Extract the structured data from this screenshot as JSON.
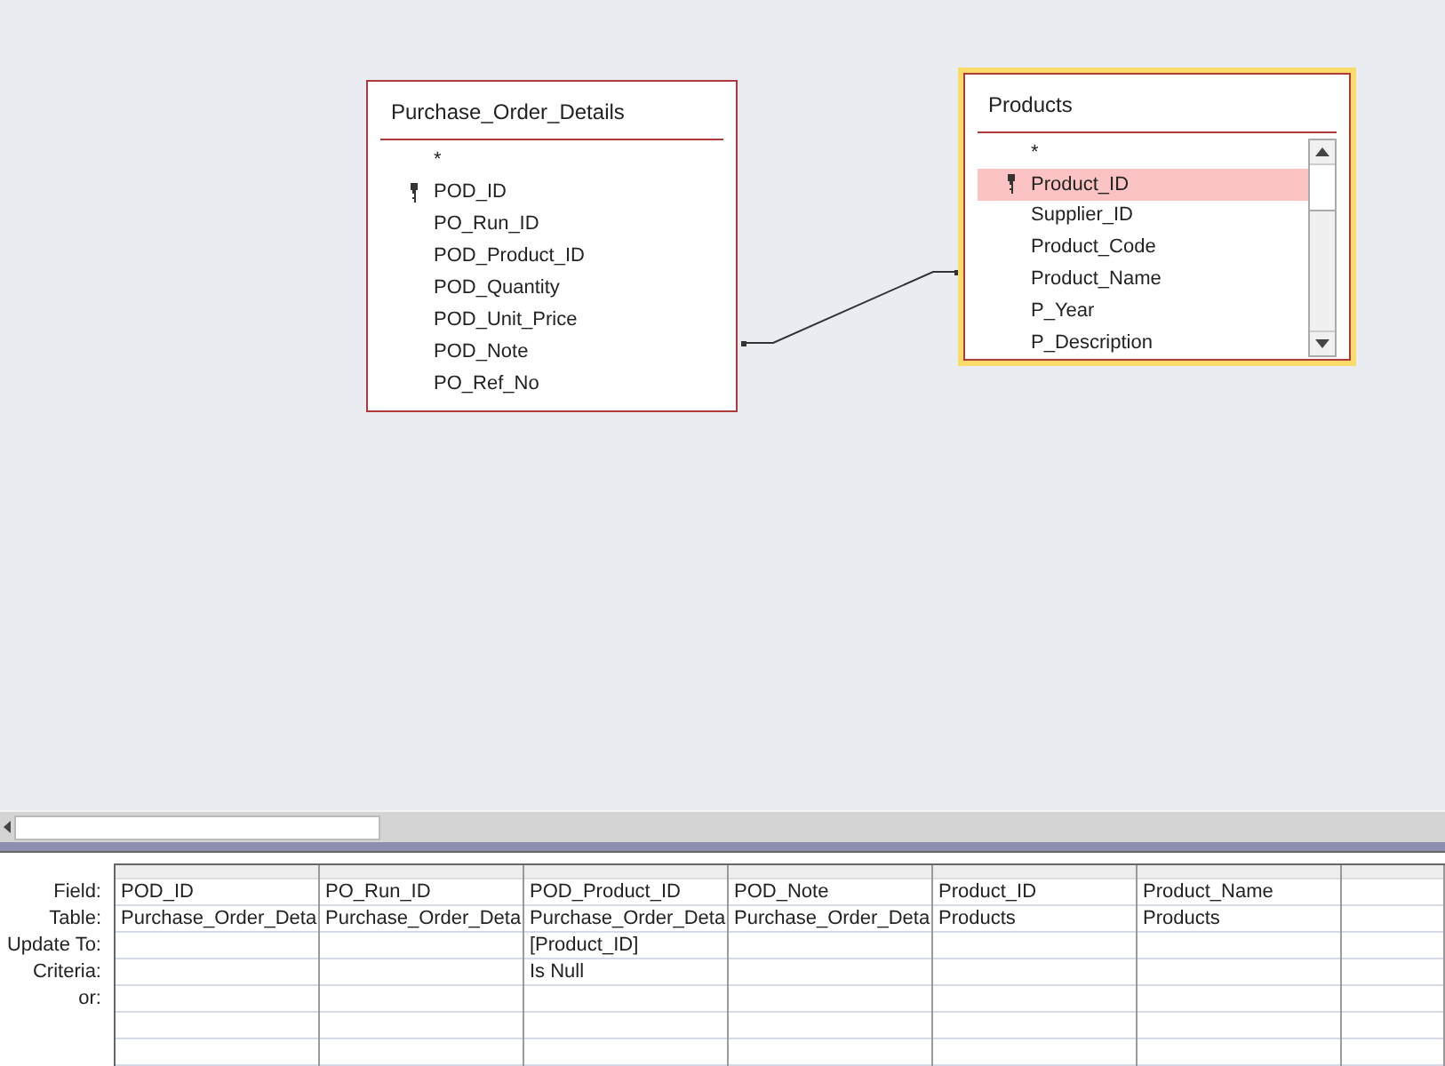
{
  "tables": [
    {
      "title": "Purchase_Order_Details",
      "active": false,
      "scrollable": false,
      "fields": [
        {
          "name": "*",
          "key": false,
          "selected": false
        },
        {
          "name": "POD_ID",
          "key": true,
          "selected": false
        },
        {
          "name": "PO_Run_ID",
          "key": false,
          "selected": false
        },
        {
          "name": "POD_Product_ID",
          "key": false,
          "selected": false
        },
        {
          "name": "POD_Quantity",
          "key": false,
          "selected": false
        },
        {
          "name": "POD_Unit_Price",
          "key": false,
          "selected": false
        },
        {
          "name": "POD_Note",
          "key": false,
          "selected": false
        },
        {
          "name": "PO_Ref_No",
          "key": false,
          "selected": false
        }
      ]
    },
    {
      "title": "Products",
      "active": true,
      "scrollable": true,
      "fields": [
        {
          "name": "*",
          "key": false,
          "selected": false
        },
        {
          "name": "Product_ID",
          "key": true,
          "selected": true
        },
        {
          "name": "Supplier_ID",
          "key": false,
          "selected": false
        },
        {
          "name": "Product_Code",
          "key": false,
          "selected": false
        },
        {
          "name": "Product_Name",
          "key": false,
          "selected": false
        },
        {
          "name": "P_Year",
          "key": false,
          "selected": false
        },
        {
          "name": "P_Description",
          "key": false,
          "selected": false
        }
      ]
    }
  ],
  "grid": {
    "row_labels": [
      "Field:",
      "Table:",
      "Update To:",
      "Criteria:",
      "or:"
    ],
    "columns": [
      {
        "field": "POD_ID",
        "table": "Purchase_Order_Deta"
      },
      {
        "field": "PO_Run_ID",
        "table": "Purchase_Order_Deta"
      },
      {
        "field": "POD_Product_ID",
        "table": "Purchase_Order_Deta",
        "update_to": "[Product_ID]",
        "criteria": "Is Null"
      },
      {
        "field": "POD_Note",
        "table": "Purchase_Order_Deta"
      },
      {
        "field": "Product_ID",
        "table": "Products"
      },
      {
        "field": "Product_Name",
        "table": "Products"
      }
    ]
  }
}
